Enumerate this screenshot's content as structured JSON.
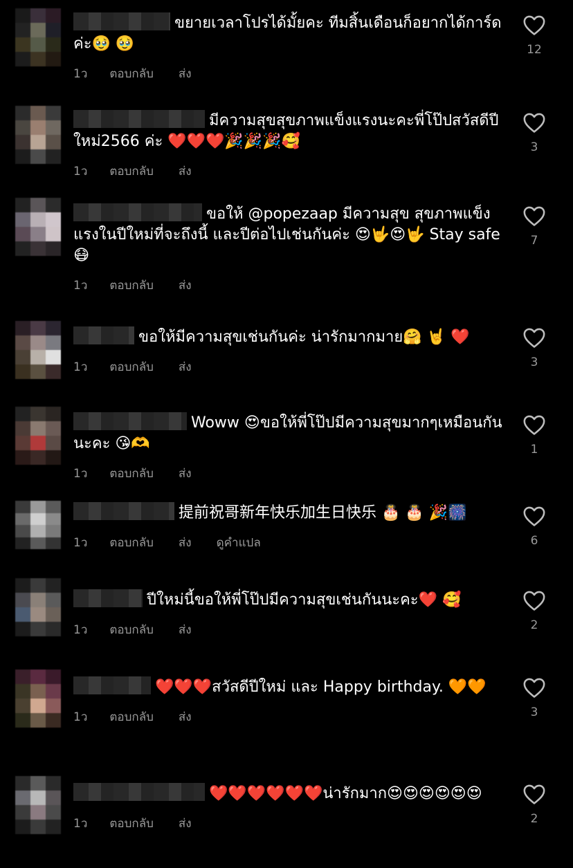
{
  "labels": {
    "time": "1ว",
    "reply": "ตอบกลับ",
    "send": "ส่ง",
    "translate": "ดูคำแปล"
  },
  "colors": {
    "background": "#000000",
    "text": "#ffffff",
    "muted": "#9a9a9a"
  },
  "icons": {
    "like": "heart-outline-icon"
  },
  "comments": [
    {
      "text": "ขยายเวลาโปรได้มั้ยคะ ทีมสิ้นเดือนก็อยากได้การ์ดค่ะ🥹 🥹",
      "likes": "12"
    },
    {
      "text": "มีความสุขสุขภาพแข็งแรงนะคะพี่โป๊ปสวัสดีปีใหม่2566 ค่ะ ❤️❤️❤️🎉🎉🎉🥰",
      "likes": "3"
    },
    {
      "text": "ขอให้ @popezaap มีความสุข สุขภาพแข็งแรงในปีใหม่ที่จะถึงนี้ และปีต่อไปเช่นกันค่ะ 😍🤟😍🤟 Stay safe 😷",
      "likes": "7"
    },
    {
      "text": "ขอให้มีความสุขเช่นกันค่ะ น่ารักมากมาย🤗 🤘 ❤️",
      "likes": "3"
    },
    {
      "text": "Woww 😍ขอให้พี่โป๊ปมีความสุขมากๆเหมือนกันนะคะ 😘🫶",
      "likes": "1"
    },
    {
      "text": "提前祝哥新年快乐加生日快乐 🎂 🎂 🎉🎆",
      "likes": "6",
      "translate": true
    },
    {
      "text": "ปีใหม่นี้ขอให้พี่โป๊ปมีความสุขเช่นกันนะคะ❤️ 🥰",
      "likes": "2"
    },
    {
      "text": "❤️❤️❤️สวัสดีปีใหม่  และ Happy birthday. 🧡🧡",
      "likes": "3"
    },
    {
      "text": "❤️❤️❤️❤️❤️❤️น่ารักมาก😍😍😍😍😍😍",
      "likes": "2"
    }
  ]
}
